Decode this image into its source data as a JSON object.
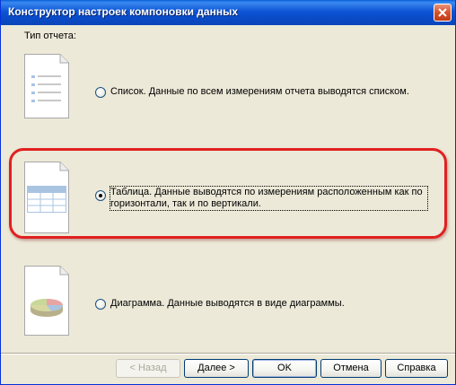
{
  "window": {
    "title": "Конструктор настроек компоновки данных"
  },
  "report_type_label": "Тип отчета:",
  "options": [
    {
      "label": "Список. Данные по всем измерениям отчета выводятся списком.",
      "icon": "list-document-icon",
      "checked": false
    },
    {
      "label": "Таблица. Данные выводятся по измерениям расположенным как по горизонтали, так и по вертикали.",
      "icon": "table-document-icon",
      "checked": true
    },
    {
      "label": "Диаграмма. Данные выводятся в виде диаграммы.",
      "icon": "pie-chart-document-icon",
      "checked": false
    }
  ],
  "buttons": {
    "back": "< Назад",
    "next": "Далее >",
    "ok": "OK",
    "cancel": "Отмена",
    "help": "Справка"
  },
  "colors": {
    "highlight": "#e02020",
    "titlebar": "#0a4bc8"
  }
}
